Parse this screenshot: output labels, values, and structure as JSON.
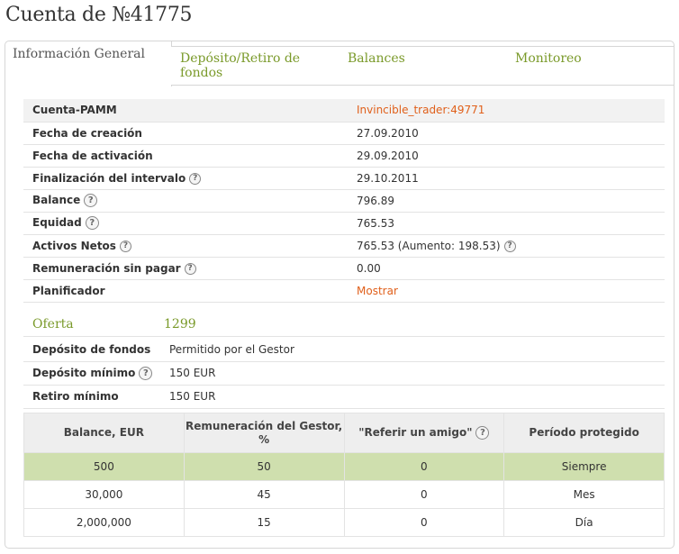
{
  "page_title": "Cuenta de №41775",
  "tabs": [
    {
      "label": "Información General"
    },
    {
      "label": "Depósito/Retiro de fondos"
    },
    {
      "label": "Balances"
    },
    {
      "label": "Monitoreo"
    }
  ],
  "account_info": [
    {
      "label": "Cuenta-PAMM",
      "value": "Invincible_trader:49771"
    },
    {
      "label": "Fecha de creación",
      "value": "27.09.2010"
    },
    {
      "label": "Fecha de activación",
      "value": "29.09.2010"
    },
    {
      "label": "Finalización del intervalo",
      "value": "29.10.2011"
    },
    {
      "label": "Balance",
      "value": "796.89"
    },
    {
      "label": "Equidad",
      "value": "765.53"
    },
    {
      "label": "Activos Netos",
      "value": "765.53 (Aumento: 198.53)"
    },
    {
      "label": "Remuneración sin pagar",
      "value": "0.00"
    },
    {
      "label": "Planificador",
      "value": "Mostrar"
    }
  ],
  "offer": {
    "label": "Oferta",
    "number": "1299",
    "rows": [
      {
        "label": "Depósito de fondos",
        "value": "Permitido por el Gestor"
      },
      {
        "label": "Depósito mínimo",
        "value": "150 EUR"
      },
      {
        "label": "Retiro mínimo",
        "value": "150 EUR"
      }
    ]
  },
  "rates_table": {
    "headers": [
      "Balance, EUR",
      "Remuneración del Gestor, %",
      "\"Referir un amigo\"",
      "Período protegido"
    ],
    "rows": [
      [
        "500",
        "50",
        "0",
        "Siempre"
      ],
      [
        "30,000",
        "45",
        "0",
        "Mes"
      ],
      [
        "2,000,000",
        "15",
        "0",
        "Día"
      ]
    ]
  },
  "colors": {
    "accent_green": "#7a9a2a",
    "link_orange": "#e0601b",
    "highlight_row": "#cfdfae"
  },
  "icons": {
    "help": "question-circle-icon",
    "help_glyph": "?"
  }
}
